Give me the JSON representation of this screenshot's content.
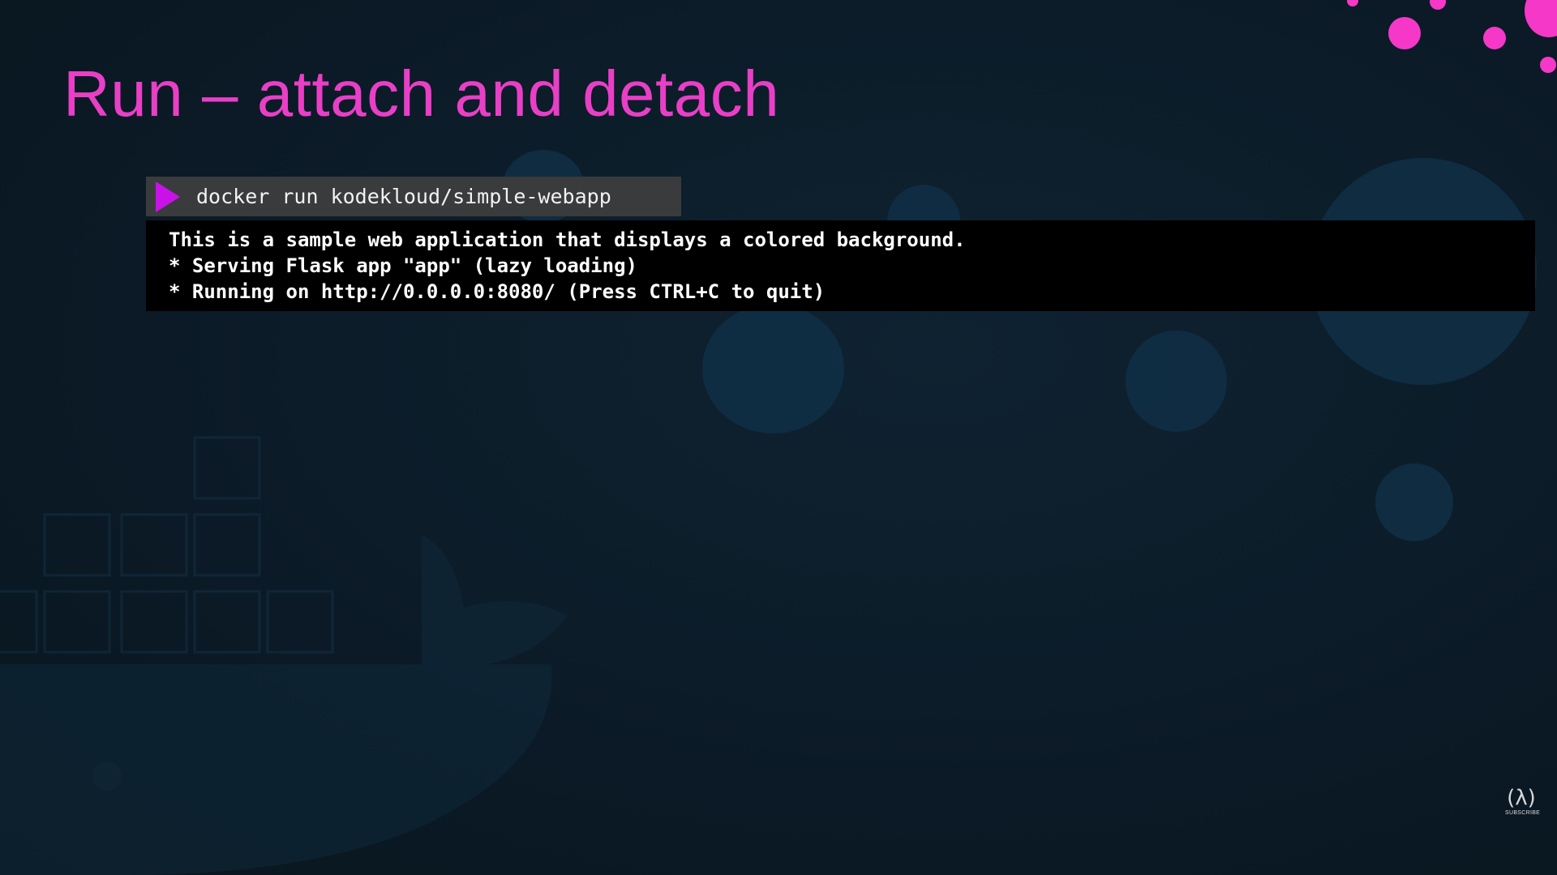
{
  "slide": {
    "title": "Run – attach and detach"
  },
  "command_bar": {
    "command": "docker run kodekloud/simple-webapp"
  },
  "terminal": {
    "lines": [
      "This is a sample web application that displays a colored background.",
      "* Serving Flask app \"app\" (lazy loading)",
      "* Running on http://0.0.0.0:8080/ (Press CTRL+C to quit)"
    ]
  },
  "subscribe_badge": {
    "label": "SUBSCRIBE",
    "icon": "(λ)"
  },
  "colors": {
    "title": "#e83fc6",
    "prompt": "#c812e8",
    "dots": "#f538c8",
    "background": "#0b1a26"
  },
  "icons": [
    "play-prompt-icon",
    "subscribe-icon"
  ]
}
